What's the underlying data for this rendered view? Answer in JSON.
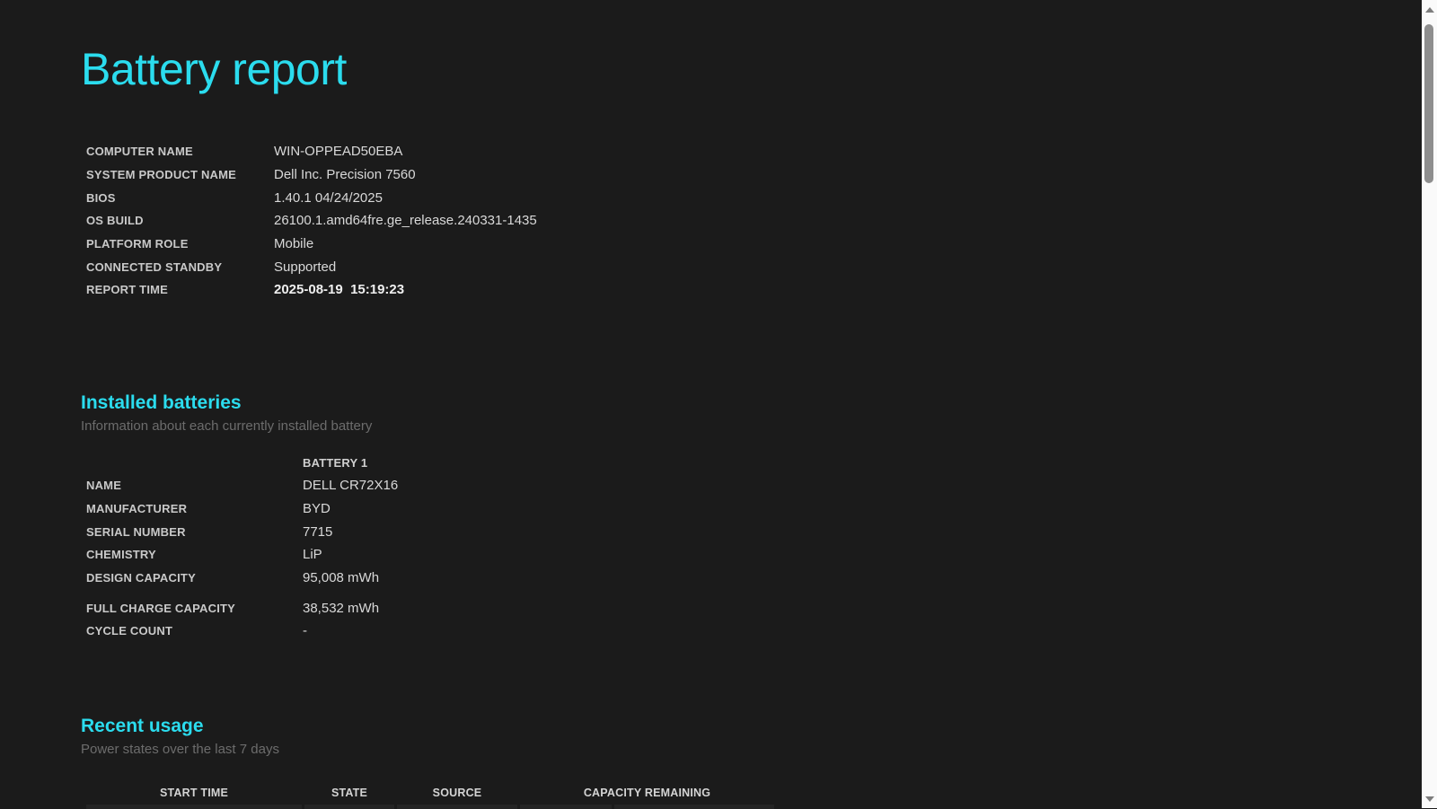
{
  "colors": {
    "accent": "#2bdcee",
    "background": "#1b1b1b",
    "muted_text": "#6c6c6c",
    "scrollbar_track": "#fafafa",
    "scrollbar_thumb": "#8e8e8e"
  },
  "page": {
    "title": "Battery report"
  },
  "system": {
    "rows": [
      {
        "label": "COMPUTER NAME",
        "value": "WIN-OPPEAD50EBA"
      },
      {
        "label": "SYSTEM PRODUCT NAME",
        "value": "Dell Inc. Precision 7560"
      },
      {
        "label": "BIOS",
        "value": "1.40.1 04/24/2025"
      },
      {
        "label": "OS BUILD",
        "value": "26100.1.amd64fre.ge_release.240331-1435"
      },
      {
        "label": "PLATFORM ROLE",
        "value": "Mobile"
      },
      {
        "label": "CONNECTED STANDBY",
        "value": "Supported"
      },
      {
        "label": "REPORT TIME",
        "value": "2025-08-19  15:19:23"
      }
    ]
  },
  "installed": {
    "heading": "Installed batteries",
    "subheading": "Information about each currently installed battery",
    "column_header": "BATTERY 1",
    "rows": [
      {
        "label": "NAME",
        "value": "DELL CR72X16"
      },
      {
        "label": "MANUFACTURER",
        "value": "BYD"
      },
      {
        "label": "SERIAL NUMBER",
        "value": "7715"
      },
      {
        "label": "CHEMISTRY",
        "value": "LiP"
      },
      {
        "label": "DESIGN CAPACITY",
        "value": "95,008 mWh"
      },
      {
        "label": "FULL CHARGE CAPACITY",
        "value": "38,532 mWh"
      },
      {
        "label": "CYCLE COUNT",
        "value": "-"
      }
    ]
  },
  "recent": {
    "heading": "Recent usage",
    "subheading": "Power states over the last 7 days",
    "columns": [
      "START TIME",
      "STATE",
      "SOURCE",
      "CAPACITY REMAINING"
    ]
  }
}
